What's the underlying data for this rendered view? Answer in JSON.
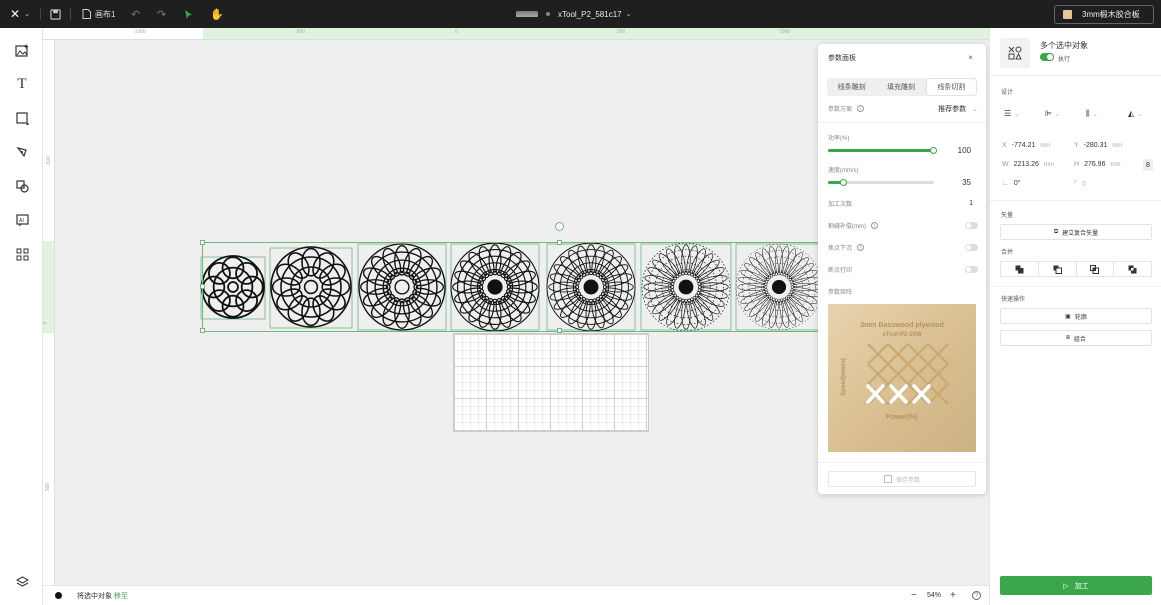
{
  "toolbar": {
    "canvas_label": "画布1",
    "file_name": "xTool_P2_581c17",
    "material_label": "3mm椴木胶合板",
    "accent": "#3aa84a"
  },
  "ruler": {
    "top_ticks": [
      "-1000",
      "-500",
      "0",
      "500",
      "1000"
    ],
    "left_ticks": [
      "-500",
      "0",
      "500"
    ]
  },
  "param_panel": {
    "title": "参数面板",
    "tabs": [
      {
        "label": "线条雕刻",
        "active": false
      },
      {
        "label": "填充雕刻",
        "active": false
      },
      {
        "label": "线条切割",
        "active": true
      }
    ],
    "scheme_label": "参数方案",
    "scheme_value": "推荐参数",
    "power_label": "功率(%)",
    "power_value": "100",
    "power_fraction": 1.0,
    "speed_label": "速度(mm/s)",
    "speed_value": "35",
    "speed_fraction": 0.15,
    "passes_label": "加工次数",
    "passes_value": "1",
    "kerf_label": "割缝补偿(mm)",
    "focus_label": "焦点下沉",
    "breakpoint_label": "断点打印",
    "matrix_label": "参数矩阵",
    "matrix_title1": "3mm Basswood plywood",
    "matrix_title2": "xTool-P2-55W",
    "matrix_xlabel": "Power(%)",
    "matrix_ylabel": "Speed(mm/s)",
    "save_label": "保存参数"
  },
  "right_panel": {
    "selection_title": "多个选中对象",
    "execute_label": "执行",
    "design_label": "设计",
    "x_label": "X",
    "x_value": "-774.21",
    "y_label": "Y",
    "y_value": "-280.31",
    "w_label": "W",
    "w_value": "2213.26",
    "h_label": "H",
    "h_value": "276.96",
    "unit": "mm",
    "rotation_value": "0°",
    "corner_value": "0",
    "vector_label": "矢量",
    "compound_label": "建立复合矢量",
    "merge_label": "合并",
    "quick_label": "快速操作",
    "outline_label": "轮廓",
    "group_label": "组合",
    "process_label": "加工"
  },
  "status": {
    "text": "将选中对象",
    "link": "移至",
    "zoom": "54%"
  }
}
